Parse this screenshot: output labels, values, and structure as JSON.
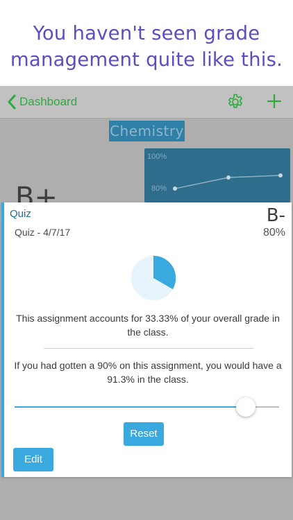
{
  "headline": {
    "line1": "You haven't seen grade",
    "line2": "management quite like this."
  },
  "navbar": {
    "back_label": "Dashboard",
    "icons": [
      "chevron-left-icon",
      "gear-icon",
      "plus-icon"
    ]
  },
  "background": {
    "class_title": "Chemistry",
    "grade": "B+",
    "chart_ticks": [
      "100%",
      "80%"
    ]
  },
  "card": {
    "title": "Quiz",
    "subtitle": "Quiz - 4/7/17",
    "letter_grade": "B-",
    "percent": "80%",
    "weight_fraction": 0.3333,
    "weight_text": "This assignment accounts for 33.33% of your overall grade in the class.",
    "whatif_text": "If you had gotten a 90% on this assignment, you would have a 91.3% in the class.",
    "slider_value": 90,
    "reset_label": "Reset",
    "edit_label": "Edit"
  },
  "colors": {
    "accent": "#39a9df",
    "nav_green": "#2bab3a",
    "headline_purple": "#5a4ec2"
  }
}
